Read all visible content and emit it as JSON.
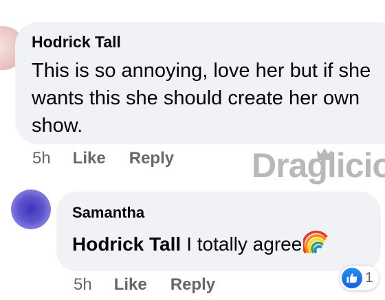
{
  "comments": [
    {
      "author": "Hodrick Tall",
      "text": "This is so annoying, love her but if she wants this she should create her own show.",
      "time": "5h",
      "like_label": "Like",
      "reply_label": "Reply"
    }
  ],
  "reply": {
    "author": "Samantha",
    "mention": "Hodrick Tall",
    "text": "I totally agree",
    "emoji": "rainbow-emoji",
    "time": "5h",
    "like_label": "Like",
    "reply_label": "Reply",
    "reaction": {
      "icon": "thumbs-up-icon",
      "count": "1",
      "color": "#1877f2"
    }
  },
  "watermark": {
    "text": "Draglicio"
  },
  "colors": {
    "bubble": "#f0f2f5",
    "meta_text": "#65676b",
    "primary_text": "#050505"
  }
}
